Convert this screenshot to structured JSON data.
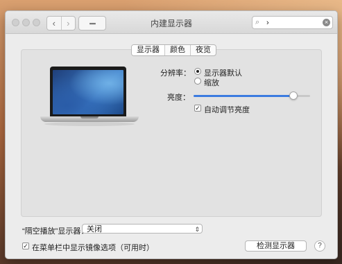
{
  "window": {
    "title": "内建显示器",
    "search_value": "›"
  },
  "nav": {
    "back_glyph": "‹",
    "forward_glyph": "›",
    "grid_glyph": "▪▪▪▪"
  },
  "tabs": [
    {
      "label": "显示器",
      "active": true
    },
    {
      "label": "颜色",
      "active": false
    },
    {
      "label": "夜览",
      "active": false
    }
  ],
  "resolution": {
    "label": "分辨率：",
    "options": [
      {
        "label": "显示器默认",
        "selected": true
      },
      {
        "label": "缩放",
        "selected": false
      }
    ]
  },
  "brightness": {
    "label": "亮度：",
    "level_fraction": 0.86,
    "auto_label": "自动调节亮度",
    "auto_checked": true
  },
  "airplay": {
    "label": "“隔空播放”显示器：",
    "value": "关闭"
  },
  "menubar_option": {
    "label": "在菜单栏中显示镜像选项（可用时）",
    "checked": true
  },
  "detect_button": "检测显示器",
  "help_glyph": "?",
  "colors": {
    "accent": "#3b7be0"
  }
}
